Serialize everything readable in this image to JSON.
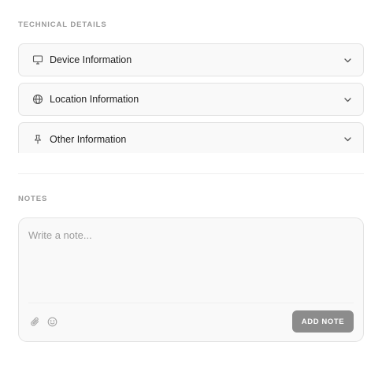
{
  "technical_details": {
    "heading": "TECHNICAL DETAILS",
    "sections": [
      {
        "label": "Device Information",
        "icon": "monitor-icon"
      },
      {
        "label": "Location Information",
        "icon": "globe-icon"
      },
      {
        "label": "Other Information",
        "icon": "pin-icon"
      }
    ]
  },
  "notes": {
    "heading": "NOTES",
    "placeholder": "Write a note...",
    "value": "",
    "add_button_label": "ADD NOTE",
    "tools": [
      "paperclip-icon",
      "smiley-icon"
    ]
  },
  "colors": {
    "label_gray": "#9a9a9a",
    "card_bg": "#f9f9f9",
    "border": "#e3e3e3",
    "button_bg": "#8c8c8c"
  }
}
